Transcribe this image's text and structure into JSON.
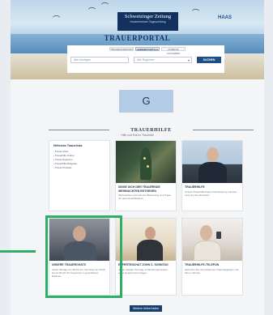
{
  "header": {
    "logo_line1": "Schwetzinger Zeitung",
    "logo_line2": "Hockenheimer Tageszeitung",
    "brand": "HAAS",
    "portal_title": "TRAUERPORTAL"
  },
  "search": {
    "tabs": [
      "TRAUERANZEIGEN",
      "GEDENKPORTALE",
      "ANZEIGE AUFGEBEN"
    ],
    "name_placeholder": "Alle Anzeigen",
    "place_placeholder": "Alle Regionen",
    "button_label": "SUCHEN"
  },
  "ad": {
    "label": "G"
  },
  "trauerhilfe": {
    "title": "TRAUERHILFE",
    "subtitle": "Hilfe und Rat im Trauerfall",
    "links_card": {
      "title": "Hilfreiche Trauerlinks",
      "items": [
        "Trauer-Chat",
        "Trauerhilfe Online",
        "Trauer-Experten",
        "Trauerhilfe-Ratgeber",
        "Trauer-Podcast"
      ]
    },
    "cards": [
      {
        "title": "SINGE DICH DER TRAUERNDE WEIHNACHTEN ENTGEGEN",
        "body": "Weihnachten eine Zeit der Besinnung und Trauer für viele Hinterbliebene."
      },
      {
        "title": "TRAUERHILFE",
        "body": "Unsere Trauerhilfe bietet Unterstützung und Rat rund um den Abschied."
      },
      {
        "title": "UNSERE TRAUERCHATS",
        "body": "Jeden Montag von 18-19 Uhr, Sonntag von 20:00 bis 21:00 Uhr für Trauernde im geschützten Rahmen."
      },
      {
        "title": "EXPERTENCHAT JOHN C. SONNTAG",
        "body": "Jeden zweiten Sonntag im Monat beantwortet unser Experte Ihre Fragen."
      },
      {
        "title": "TRAUERHILFE-TELEFON",
        "body": "Sprechen Sie mit erfahrenen Trauerbegleitern, die Ihnen zuhören."
      }
    ],
    "more_button": "Weitere Artikel laden"
  }
}
